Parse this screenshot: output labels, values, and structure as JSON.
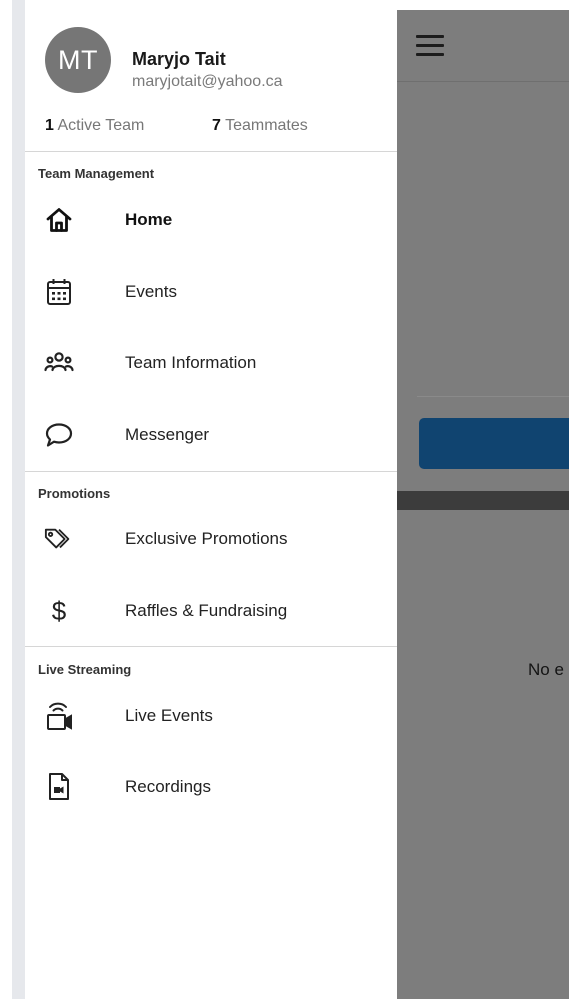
{
  "user": {
    "initials": "MT",
    "name": "Maryjo Tait",
    "email": "maryjotait@yahoo.ca",
    "active_team_count": "1",
    "active_team_label": "Active Team",
    "teammates_count": "7",
    "teammates_label": "Teammates"
  },
  "sections": {
    "team_management": {
      "title": "Team Management",
      "items": [
        {
          "label": "Home",
          "icon": "home-icon",
          "active": true
        },
        {
          "label": "Events",
          "icon": "calendar-icon"
        },
        {
          "label": "Team Information",
          "icon": "team-icon"
        },
        {
          "label": "Messenger",
          "icon": "chat-bubble-icon"
        }
      ]
    },
    "promotions": {
      "title": "Promotions",
      "items": [
        {
          "label": "Exclusive Promotions",
          "icon": "tags-icon"
        },
        {
          "label": "Raffles & Fundraising",
          "icon": "dollar-icon"
        }
      ]
    },
    "live_streaming": {
      "title": "Live Streaming",
      "items": [
        {
          "label": "Live Events",
          "icon": "live-camera-icon"
        },
        {
          "label": "Recordings",
          "icon": "video-file-icon"
        }
      ]
    }
  },
  "background": {
    "empty_text": "No e"
  },
  "colors": {
    "avatar_bg": "#767676",
    "primary_button": "#104470",
    "overlay": "#7d7d7d"
  }
}
